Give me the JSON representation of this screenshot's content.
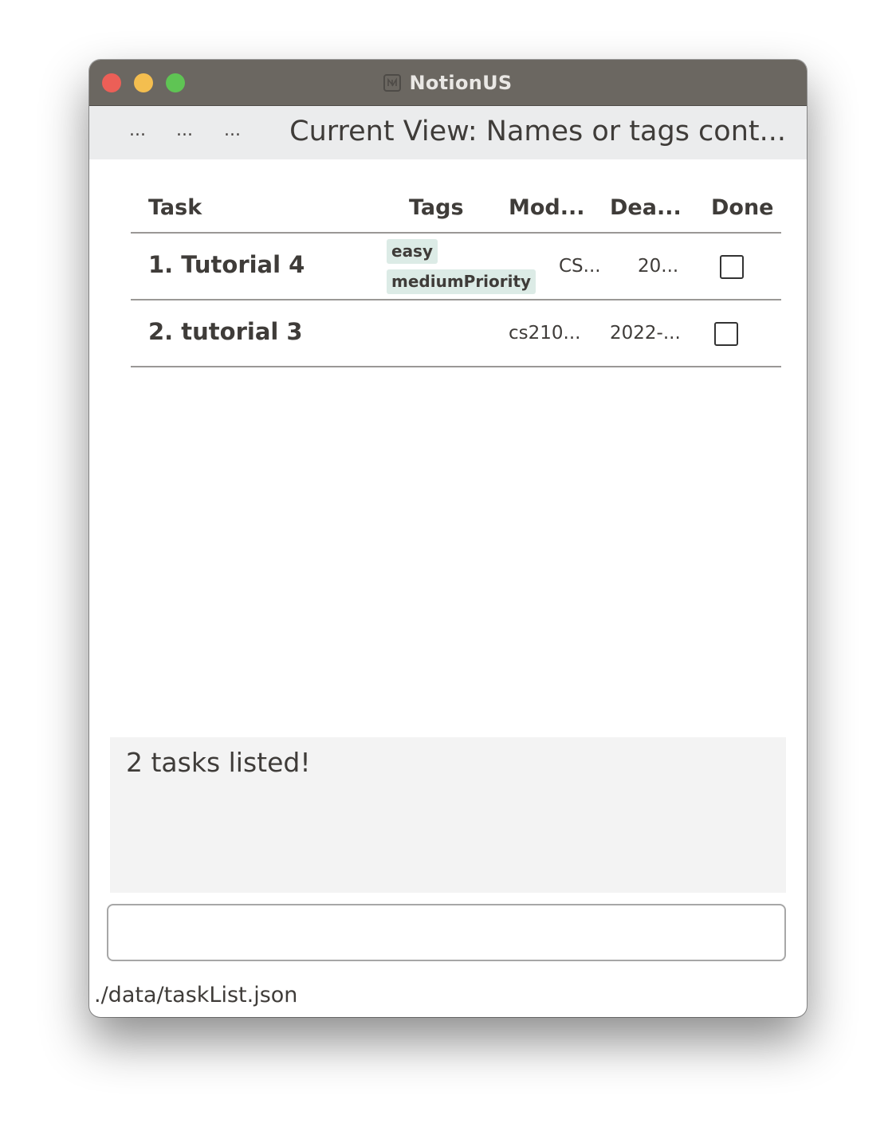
{
  "window": {
    "title": "NotionUS"
  },
  "menubar": {
    "items": [
      "...",
      "...",
      "..."
    ],
    "current_view": "Current View: Names or tags cont..."
  },
  "table": {
    "headers": {
      "task": "Task",
      "tags": "Tags",
      "module": "Mod...",
      "deadline": "Dea...",
      "done": "Done"
    },
    "rows": [
      {
        "name": "1. Tutorial 4",
        "tags": [
          "easy",
          "mediumPriority"
        ],
        "module": "CS...",
        "deadline": "20...",
        "done": false
      },
      {
        "name": "2. tutorial 3",
        "tags": [],
        "module": "cs210...",
        "deadline": "2022-...",
        "done": false
      }
    ]
  },
  "result": {
    "text": "2 tasks listed!"
  },
  "command": {
    "value": "",
    "placeholder": ""
  },
  "status": {
    "file_path": "./data/taskList.json"
  },
  "colors": {
    "titlebar": "#6b6761",
    "menubar": "#ebeced",
    "tag_bg": "#dcebe6",
    "result_bg": "#f3f3f3",
    "close": "#ec5f57",
    "minimize": "#f4be4f",
    "maximize": "#5fc454"
  }
}
